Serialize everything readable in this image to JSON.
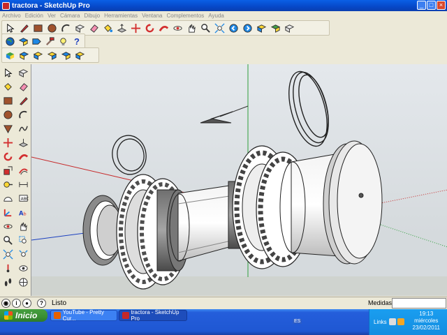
{
  "window": {
    "title": "tractora - SketchUp Pro",
    "buttons": [
      "_",
      "□",
      "×"
    ]
  },
  "menubar": {
    "items": [
      "Archivo",
      "Edición",
      "Ver",
      "Cámara",
      "Dibujo",
      "Herramientas",
      "Ventana",
      "Complementos",
      "Ayuda"
    ]
  },
  "toolbars": {
    "main": [
      "select-arrow-icon",
      "pencil-line-icon",
      "rectangle-icon",
      "circle-icon",
      "arc-icon",
      "make-component-icon",
      "eraser-icon",
      "paint-bucket-icon",
      "push-pull-icon",
      "move-icon",
      "rotate-icon",
      "follow-me-icon",
      "orbit-icon",
      "pan-icon",
      "zoom-icon",
      "zoom-extents-icon",
      "previous-view-icon",
      "next-view-icon",
      "get-models-icon",
      "share-model-icon",
      "share-component-icon"
    ],
    "second": [
      "google-earth-icon",
      "layer-icon",
      "tag-icon",
      "hammer-icon",
      "lightbulb-icon",
      "help-icon"
    ],
    "third": [
      "iso-view-icon",
      "top-view-icon",
      "front-view-icon",
      "right-view-icon",
      "back-view-icon",
      "left-view-icon"
    ]
  },
  "status": {
    "text": "Listo",
    "measure_label": "Medidas",
    "measure_value": ""
  },
  "taskbar": {
    "start_label": "Inicio",
    "tasks": [
      "YouTube - Pretty Cur...",
      "tractora - SketchUp Pro"
    ],
    "lang": "ES",
    "links_label": "Links",
    "time": "19:13",
    "day": "miércoles",
    "date": "23/02/2011"
  },
  "colors": {
    "accent_xp_blue": "#245edb",
    "start_green": "#3a8f34",
    "axis_red": "#c62828",
    "axis_green": "#2e9e3a",
    "axis_blue": "#1a3fbf"
  }
}
